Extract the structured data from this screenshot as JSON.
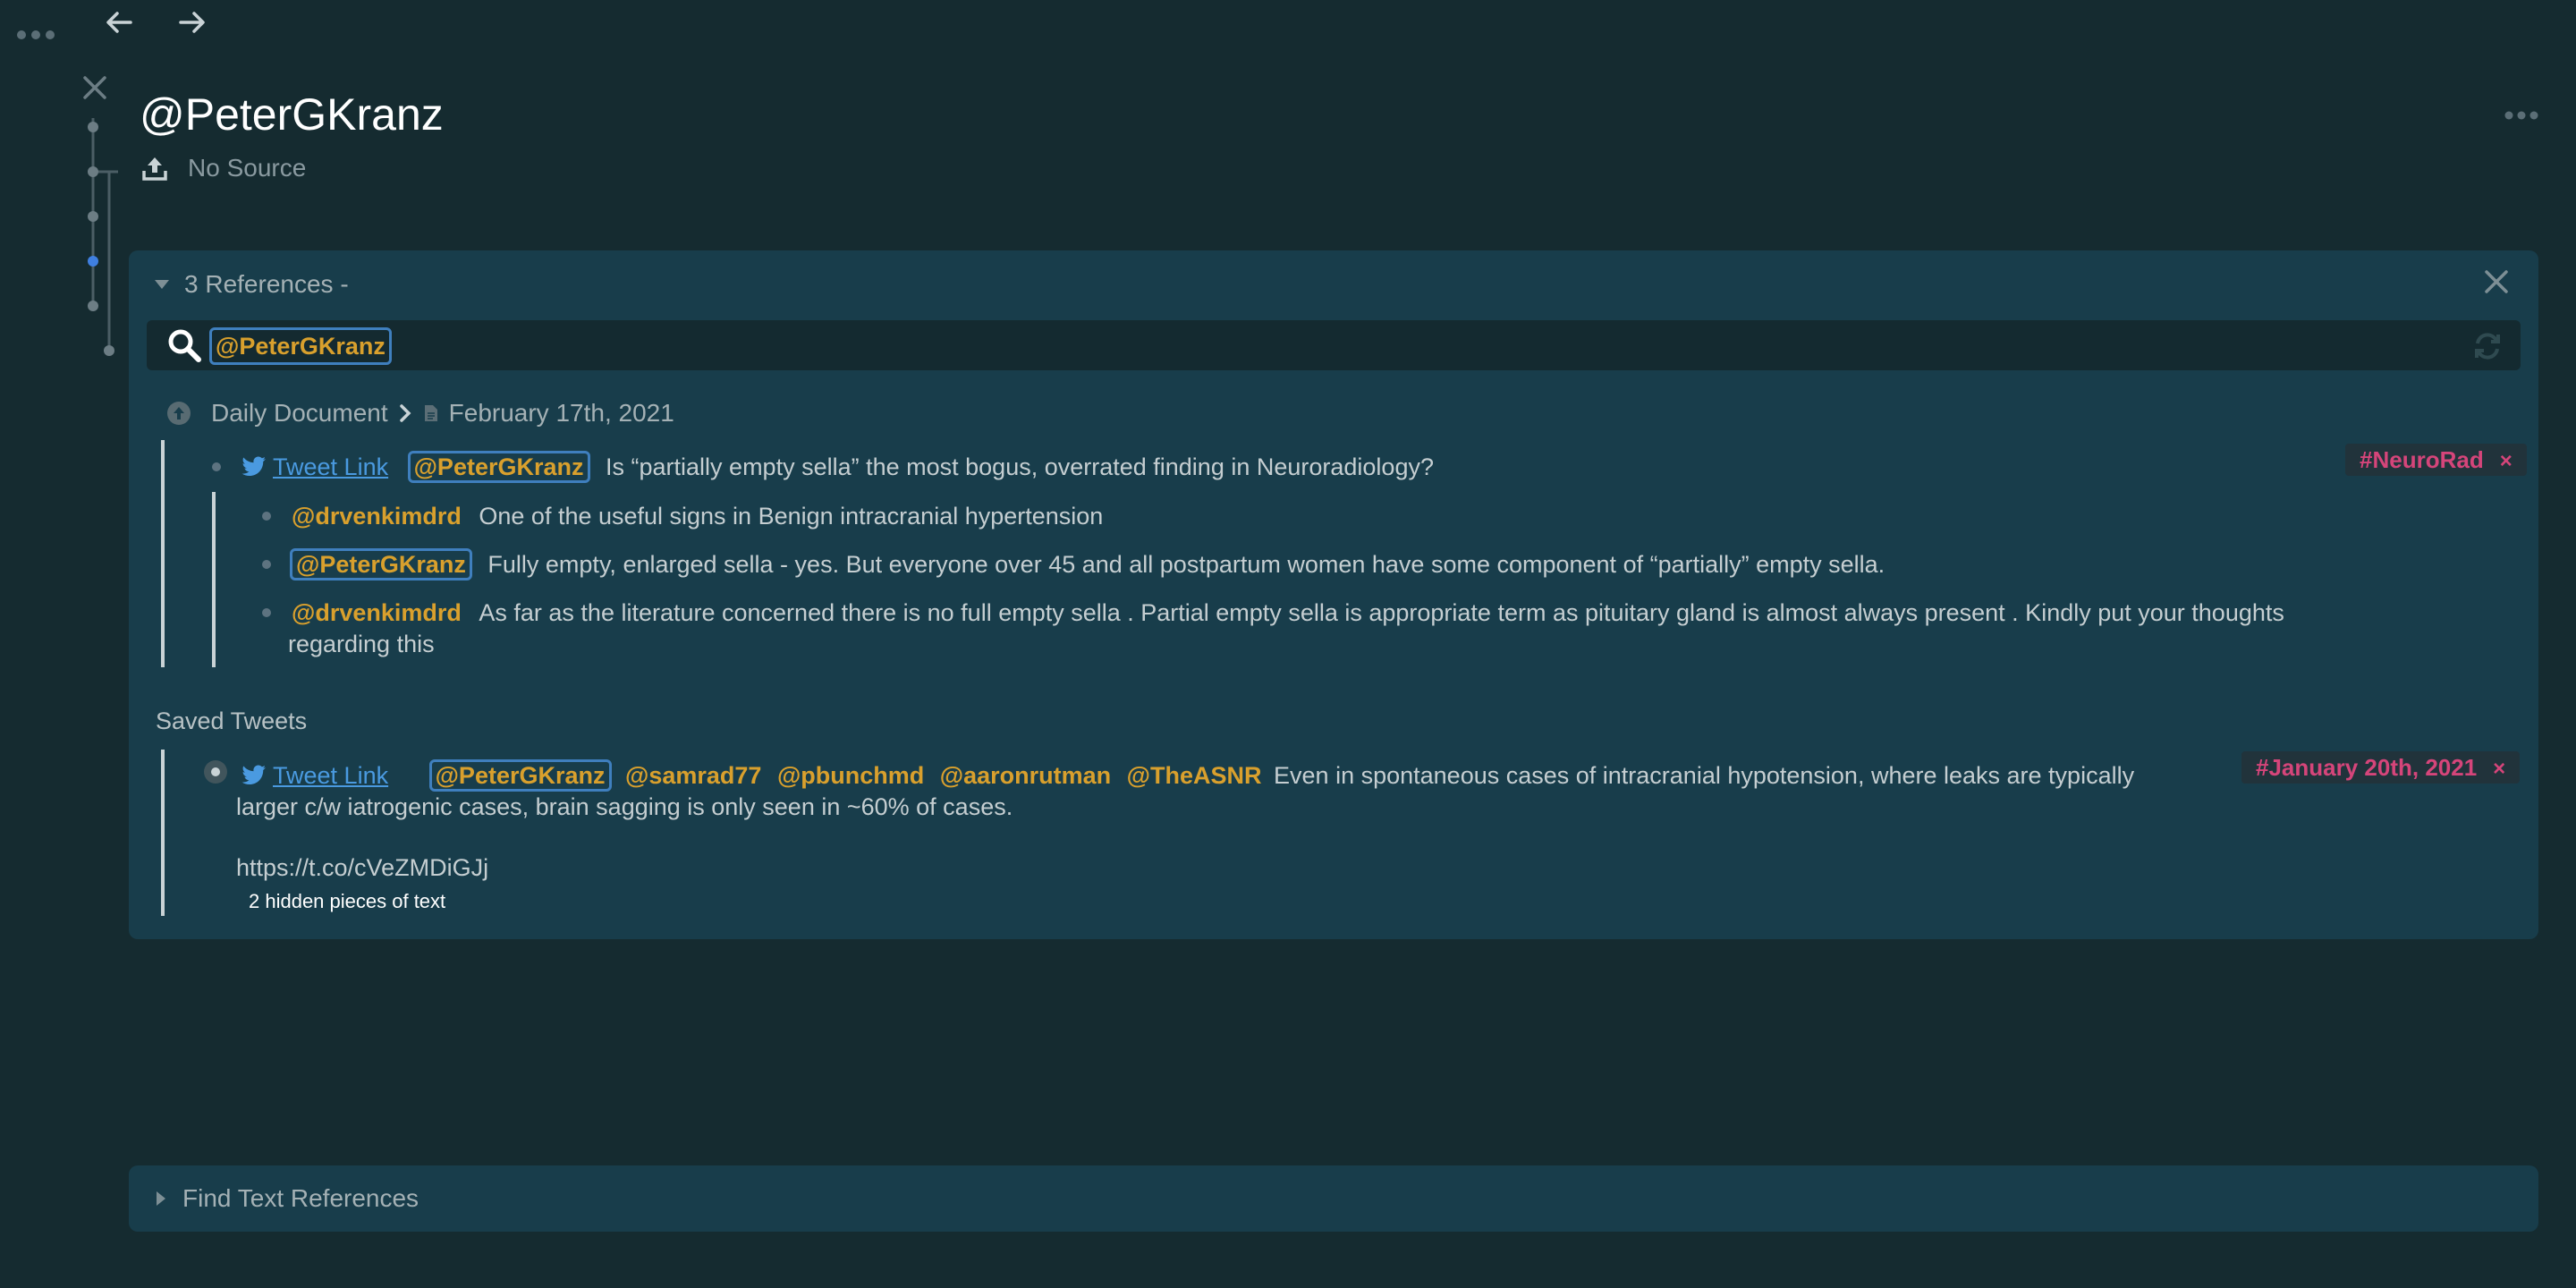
{
  "toolbar": {
    "menu_icon": "ellipsis-icon",
    "back_icon": "arrow-left-icon",
    "forward_icon": "arrow-right-icon"
  },
  "page": {
    "title": "@PeterGKranz",
    "source_label": "No Source"
  },
  "references": {
    "header": "3 References -",
    "search_value": "@PeterGKranz",
    "breadcrumb": {
      "root": "Daily Document",
      "page": "February 17th, 2021"
    },
    "main_tweet": {
      "link": "Tweet Link",
      "mention": "@PeterGKranz",
      "text": "Is “partially empty sella” the most bogus, overrated finding in Neuroradiology?",
      "tag": "#NeuroRad",
      "tag_close": "×"
    },
    "replies": [
      {
        "mention": "@drvenkimdrd",
        "text": "One of the useful signs in Benign intracranial hypertension"
      },
      {
        "mention": "@PeterGKranz",
        "text": "Fully empty, enlarged sella - yes.  But everyone over 45 and all postpartum women have some component of “partially” empty sella."
      },
      {
        "mention": "@drvenkimdrd",
        "text": "As far as the literature concerned there is no full empty sella . Partial empty sella is appropriate term as pituitary gland is almost always present . Kindly put your thoughts",
        "text2": "regarding this"
      }
    ],
    "saved_tweets": {
      "heading": "Saved Tweets",
      "link": "Tweet Link",
      "mentions": [
        "@PeterGKranz",
        "@samrad77",
        "@pbunchmd",
        "@aaronrutman",
        "@TheASNR"
      ],
      "text": "Even in spontaneous cases of intracranial hypotension, where leaks are typically",
      "text2": "larger c/w iatrogenic cases, brain sagging is only seen in ~60% of cases.",
      "url": "https://t.co/cVeZMDiGJj",
      "hidden_note": "2 hidden pieces of text",
      "tag": "#January 20th, 2021",
      "tag_close": "×"
    }
  },
  "find_text": {
    "label": "Find Text References"
  },
  "colors": {
    "background": "#152b30",
    "panel": "#183d4b",
    "mention": "#d9a02d",
    "link": "#4a9ae0",
    "tag": "#d5457a"
  }
}
